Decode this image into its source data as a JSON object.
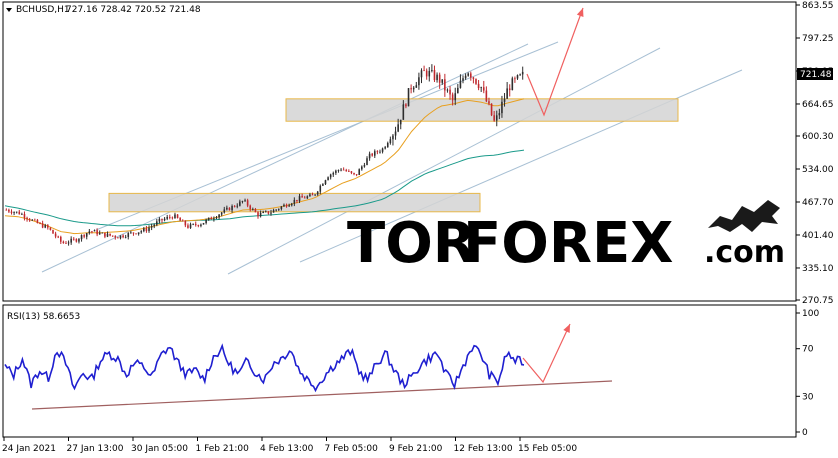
{
  "header": {
    "menu_icon": "triangle-down-icon",
    "symbol": "BCHUSD,H1",
    "ohlc": "727.16 728.42 720.52 721.48"
  },
  "logo": {
    "part1": "TOR",
    "part2": "FOREX",
    "part3": ".com",
    "icon": "bull-bear-icon",
    "colors": {
      "dark": "#1a1a1a",
      "accent": "#f15a22"
    }
  },
  "colors": {
    "candle_up": "#2d2d2d",
    "candle_down": "#c0282d",
    "ma_fast": "#e8a020",
    "ma_slow": "#1a9a8a",
    "channel": "#a8c0d4",
    "zone_fill": "#d4d4d4",
    "zone_border": "#e8b84a",
    "arrow": "#f06060",
    "rsi": "#1f1fd0",
    "rsi_trend": "#a06060",
    "price_tag_bg": "#000000"
  },
  "chart_data": [
    {
      "type": "candlestick",
      "ylim": [
        270.75,
        863.55
      ],
      "y_ticks": [
        "863.55",
        "797.25",
        "730.95",
        "664.65",
        "600.30",
        "534.00",
        "467.70",
        "401.40",
        "335.10",
        "270.75"
      ],
      "x_ticks": [
        "24 Jan 2021",
        "27 Jan 13:00",
        "30 Jan 05:00",
        "1 Feb 21:00",
        "4 Feb 13:00",
        "7 Feb 05:00",
        "9 Feb 21:00",
        "12 Feb 13:00",
        "15 Feb 05:00"
      ],
      "last_price": "721.48",
      "key_closes": [
        452,
        445,
        428,
        415,
        385,
        392,
        410,
        402,
        398,
        405,
        412,
        430,
        440,
        418,
        425,
        440,
        455,
        470,
        442,
        448,
        462,
        475,
        480,
        520,
        535,
        520,
        560,
        575,
        620,
        700,
        730,
        715,
        670,
        735,
        700,
        625,
        700,
        721.48
      ],
      "ma_fast": [
        440,
        438,
        430,
        420,
        408,
        404,
        406,
        406,
        408,
        410,
        415,
        422,
        428,
        430,
        432,
        436,
        444,
        452,
        452,
        455,
        460,
        468,
        475,
        490,
        505,
        515,
        530,
        545,
        570,
        610,
        640,
        660,
        665,
        672,
        668,
        660,
        668,
        675
      ],
      "ma_slow": [
        460,
        455,
        448,
        442,
        434,
        428,
        425,
        422,
        420,
        420,
        422,
        425,
        428,
        430,
        431,
        432,
        434,
        438,
        440,
        442,
        444,
        446,
        448,
        452,
        456,
        460,
        466,
        474,
        490,
        510,
        525,
        535,
        545,
        555,
        560,
        562,
        568,
        572
      ],
      "zones": [
        {
          "from": 630,
          "to": 675
        },
        {
          "from": 448,
          "to": 485
        }
      ]
    },
    {
      "type": "line",
      "title": "RSI(13) 58.6653",
      "ylim": [
        0,
        100
      ],
      "y_ticks": [
        "100",
        "70",
        "30",
        "0"
      ],
      "values": [
        55,
        48,
        62,
        40,
        52,
        45,
        70,
        58,
        36,
        50,
        44,
        60,
        66,
        62,
        48,
        58,
        55,
        46,
        64,
        72,
        58,
        48,
        52,
        44,
        62,
        70,
        56,
        48,
        60,
        50,
        44,
        58,
        62,
        70,
        52,
        44,
        38,
        48,
        56,
        62,
        68,
        50,
        44,
        58,
        66,
        52,
        40,
        46,
        56,
        62,
        66,
        48,
        40,
        56,
        72,
        66,
        48,
        42,
        66,
        60,
        58.67
      ]
    }
  ]
}
